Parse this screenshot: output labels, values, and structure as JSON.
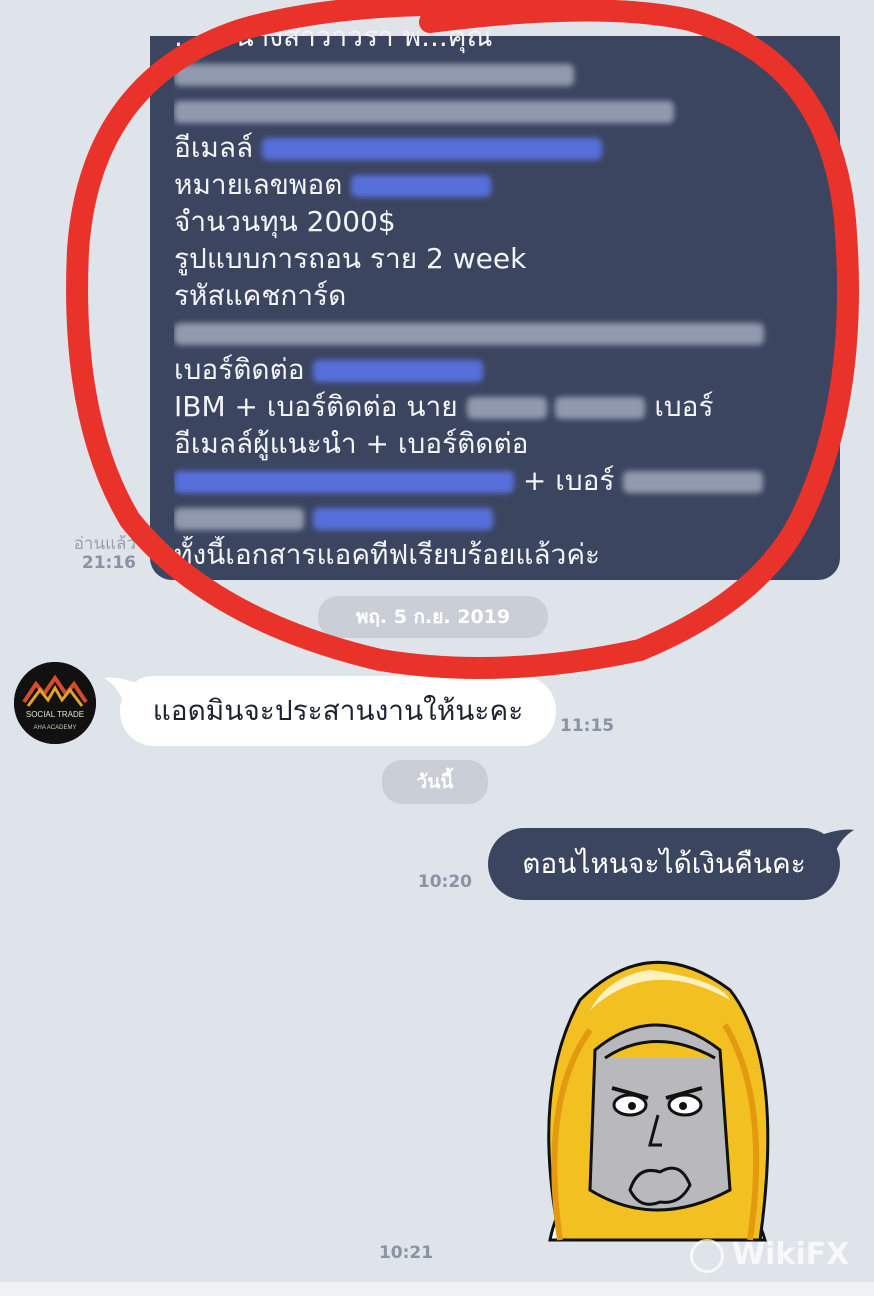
{
  "messages": {
    "first": {
      "lines": [
        "...ุณ นางสาวาวรา พ...คุณ",
        "",
        "",
        "อีเมลล์",
        "หมายเลขพอต",
        "จำนวนทุน  2000$",
        "รูปแบบการถอน  ราย 2 week",
        "รหัสแคชการ์ด",
        "",
        "เบอร์ติดต่อ",
        "IBM + เบอร์ติดต่อ  นาย",
        "อีเมลล์ผู้แนะนำ + เบอร์ติดต่อ",
        "+ เบอร์",
        "",
        "ทั้งนี้เอกสารแอคทีฟเรียบร้อยแล้วค่ะ"
      ],
      "read_status": "อ่านแล้ว",
      "time": "21:16"
    },
    "date_1": "พฤ. 5 ก.ย. 2019",
    "admin_reply": {
      "text": "แอดมินจะประสานงานให้นะคะ",
      "time": "11:15"
    },
    "date_2": "วันนี้",
    "user_question": {
      "text": "ตอนไหนจะได้เงินคืนคะ",
      "time": "10:20"
    },
    "sticker_time": "10:21"
  },
  "avatar": {
    "line1": "SOCIAL TRADE",
    "line2": "AHA ACADEMY"
  },
  "watermark": "WikiFX",
  "colors": {
    "background": "#dfe3ea",
    "sent_bubble": "#3b4560",
    "received_bubble": "#ffffff",
    "annotation_circle": "#e8322a",
    "link": "#5b74e8"
  }
}
